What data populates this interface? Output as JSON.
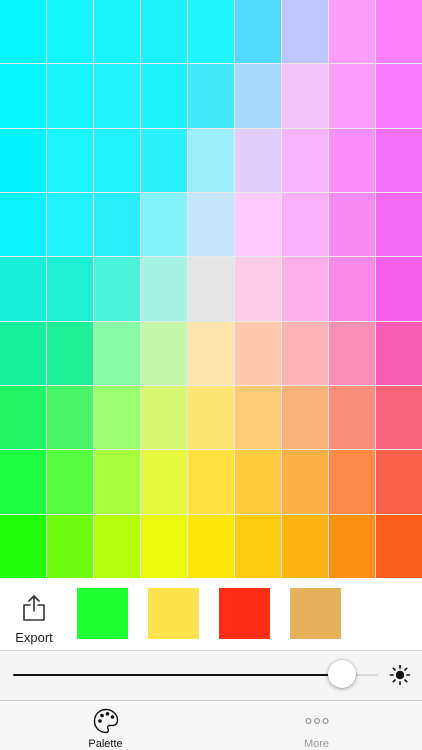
{
  "palette": {
    "rows": [
      [
        "#00f5fc",
        "#14f5fc",
        "#18f4fa",
        "#1cf1fb",
        "#1ff4fc",
        "#52dafc",
        "#bfc6ff",
        "#fa9efa",
        "#fb7ffb"
      ],
      [
        "#00f5fc",
        "#19f3fc",
        "#21f2fb",
        "#1ff1fb",
        "#43e8fb",
        "#a6d8fc",
        "#f5c3fb",
        "#fb9dfa",
        "#f977fa"
      ],
      [
        "#00f4fc",
        "#1cf4fb",
        "#20f1fb",
        "#2af1fb",
        "#9ceefb",
        "#e2cefd",
        "#f8b4fb",
        "#fa8ffa",
        "#f66ff7"
      ],
      [
        "#0cf1fa",
        "#22f1fb",
        "#29eef9",
        "#82f3f9",
        "#c4e5fd",
        "#ffcbfe",
        "#f8b0f8",
        "#f88cf3",
        "#f56af5"
      ],
      [
        "#19efd7",
        "#1eeed2",
        "#4af2d7",
        "#a6f3e3",
        "#e4e4e4",
        "#fccbe6",
        "#fbb0ea",
        "#f889e6",
        "#f560ea"
      ],
      [
        "#18f09d",
        "#1ff097",
        "#87fba3",
        "#c3f8ab",
        "#fde4ad",
        "#fec9ad",
        "#fcb3b5",
        "#fa8fb5",
        "#f75db4"
      ],
      [
        "#20f666",
        "#49f366",
        "#9bfd6d",
        "#d7f873",
        "#fde574",
        "#fdca75",
        "#fbb279",
        "#fb8d7b",
        "#f7637d"
      ],
      [
        "#1dff3e",
        "#55fb3e",
        "#a7fe3d",
        "#e5fa3d",
        "#ffe13f",
        "#fecb41",
        "#fbb146",
        "#fc8b47",
        "#f8614b"
      ],
      [
        "#1dff0b",
        "#70fc0e",
        "#b5fe0e",
        "#ecfb0e",
        "#ffe60c",
        "#ffcc11",
        "#feb514",
        "#fb9016",
        "#f95e1a"
      ]
    ]
  },
  "export": {
    "label": "Export",
    "icon": "share-icon"
  },
  "swatches": [
    {
      "color": "#1dff32"
    },
    {
      "color": "#ffe34e"
    },
    {
      "color": "#ff2d14"
    },
    {
      "color": "#e6b35c"
    }
  ],
  "brightness": {
    "level": 0.9,
    "icon": "brightness-icon"
  },
  "tabs": [
    {
      "label": "Palette",
      "icon": "palette-icon",
      "active": true
    },
    {
      "label": "More",
      "icon": "more-icon",
      "active": false
    }
  ]
}
